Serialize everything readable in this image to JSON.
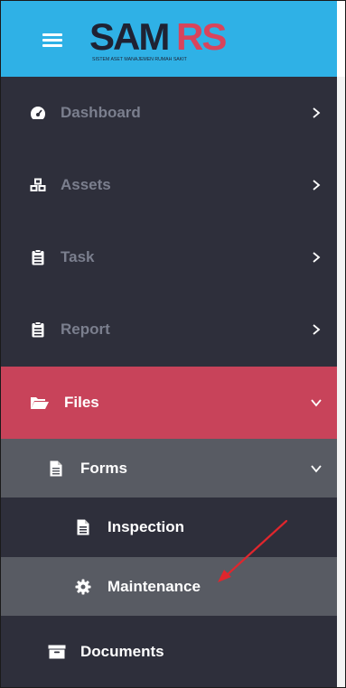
{
  "header": {
    "logo_main": "SAM",
    "logo_accent": "RS",
    "logo_tagline": "SISTEM ASET MANAJEMEN RUMAH SAKIT"
  },
  "menu": {
    "dashboard": "Dashboard",
    "assets": "Assets",
    "task": "Task",
    "report": "Report",
    "files": "Files",
    "forms": "Forms",
    "inspection": "Inspection",
    "maintenance": "Maintenance",
    "documents": "Documents"
  },
  "icons": {
    "menu": "hamburger-icon",
    "dashboard": "tachometer-icon",
    "assets": "cubes-icon",
    "task": "clipboard-icon",
    "report": "clipboard-icon",
    "files": "folder-open-icon",
    "forms": "file-icon",
    "inspection": "file-icon",
    "maintenance": "gear-icon",
    "documents": "archive-icon"
  },
  "colors": {
    "header_bg": "#2fb1e6",
    "sidebar_bg": "#2e2f3b",
    "active_bg": "#c8435a",
    "submenu_active_bg": "#585b63",
    "logo_dark": "#1f2233",
    "logo_accent": "#d9445c",
    "annotation_arrow": "#e0262d"
  }
}
